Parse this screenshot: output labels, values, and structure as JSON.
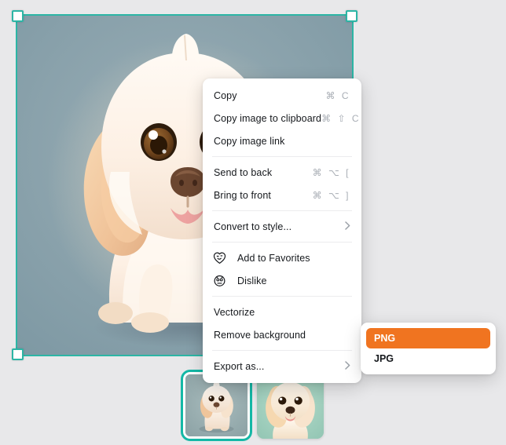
{
  "canvas": {
    "background_color": "#e8e8ea",
    "selection_color": "#2cb5a5",
    "image_alt": "illustrated cream colored puppy on blue-grey background",
    "image_background_color": "#8ba2ac"
  },
  "context_menu": {
    "groups": [
      {
        "items": [
          {
            "label": "Copy",
            "shortcut": "⌘ C",
            "icon": null,
            "submenu": false
          },
          {
            "label": "Copy image to clipboard",
            "shortcut": "⌘ ⇧ C",
            "icon": null,
            "submenu": false
          },
          {
            "label": "Copy image link",
            "shortcut": "",
            "icon": null,
            "submenu": false
          }
        ]
      },
      {
        "items": [
          {
            "label": "Send to back",
            "shortcut": "⌘ ⌥ [",
            "icon": null,
            "submenu": false
          },
          {
            "label": "Bring to front",
            "shortcut": "⌘ ⌥ ]",
            "icon": null,
            "submenu": false
          }
        ]
      },
      {
        "items": [
          {
            "label": "Convert to style...",
            "shortcut": "",
            "icon": null,
            "submenu": true
          }
        ]
      },
      {
        "items": [
          {
            "label": "Add to Favorites",
            "shortcut": "",
            "icon": "heart-smiley-icon",
            "submenu": false
          },
          {
            "label": "Dislike",
            "shortcut": "",
            "icon": "sad-face-icon",
            "submenu": false
          }
        ]
      },
      {
        "items": [
          {
            "label": "Vectorize",
            "shortcut": "",
            "icon": null,
            "submenu": false
          },
          {
            "label": "Remove background",
            "shortcut": "",
            "icon": null,
            "submenu": false
          }
        ]
      },
      {
        "items": [
          {
            "label": "Export as...",
            "shortcut": "",
            "icon": null,
            "submenu": true
          }
        ]
      }
    ]
  },
  "export_submenu": {
    "highlight_color": "#f07420",
    "options": [
      {
        "label": "PNG",
        "active": true
      },
      {
        "label": "JPG",
        "active": false
      }
    ]
  },
  "thumbnails": {
    "selection_color": "#14b8a6",
    "items": [
      {
        "alt": "puppy sitting full body thumbnail",
        "selected": true
      },
      {
        "alt": "puppy close up portrait thumbnail",
        "selected": false
      }
    ]
  }
}
